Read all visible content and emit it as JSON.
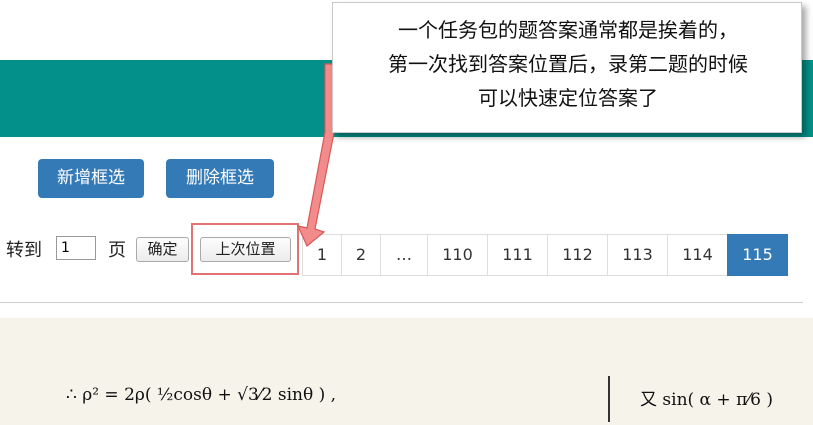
{
  "toolbar": {
    "add_selection": "新增框选",
    "delete_selection": "删除框选"
  },
  "pagination": {
    "goto_label": "转到",
    "page_input_value": "1",
    "page_unit": "页",
    "confirm": "确定",
    "last_position": "上次位置",
    "pages": [
      "1",
      "2",
      "…",
      "110",
      "111",
      "112",
      "113",
      "114",
      "115"
    ],
    "active_page": "115"
  },
  "scan": {
    "left_formula": "∴ ρ² = 2ρ( ½cosθ + √3⁄2 sinθ ) ,",
    "right_formula": "又 sin( α + π⁄6 )"
  },
  "callout": {
    "text": "一个任务包的题答案通常都是挨着的，\n第一次找到答案位置后，录第二题的时候\n可以快速定位答案了"
  },
  "colors": {
    "teal": "#03908a",
    "primary": "#337ab7",
    "annotation_red": "#e57272"
  }
}
